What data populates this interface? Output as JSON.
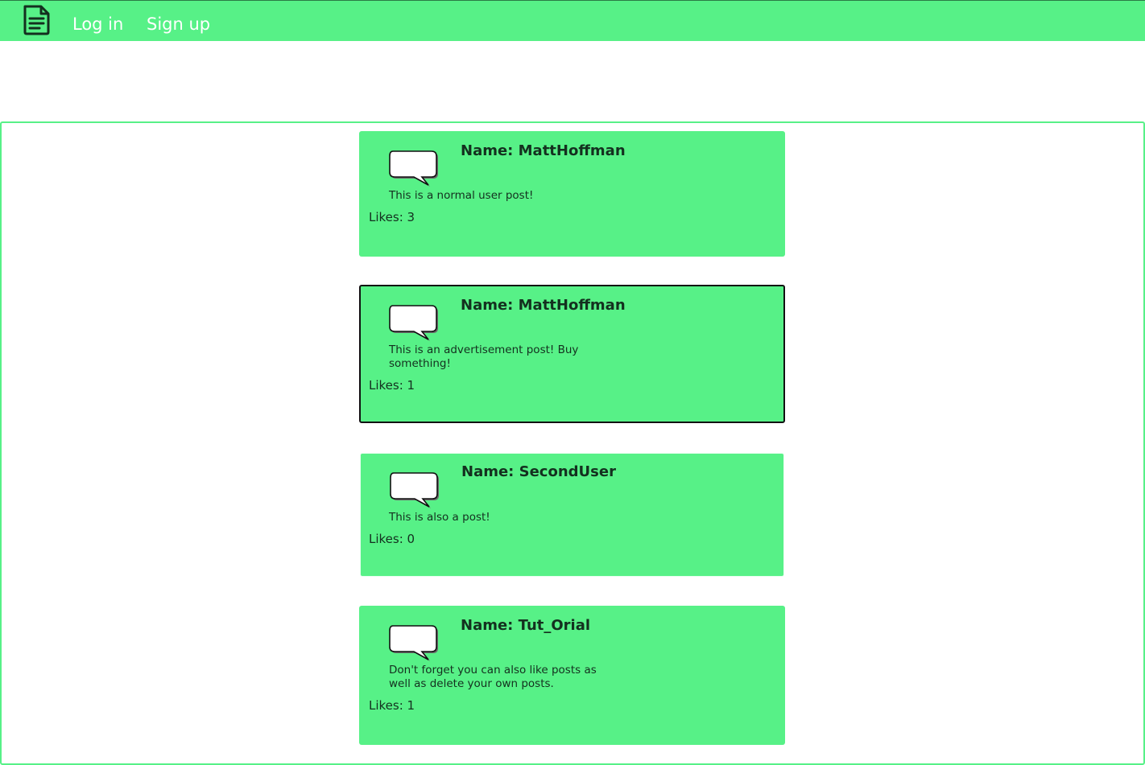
{
  "nav": {
    "logo_icon": "document-icon",
    "login_label": "Log in",
    "signup_label": "Sign up"
  },
  "colors": {
    "accent": "#57f187",
    "text_dark": "#14301f",
    "nav_text": "#ffffff"
  },
  "posts": [
    {
      "name": "Name: MattHoffman",
      "body": "This is a normal user post!",
      "likes": "Likes: 3",
      "icon": "speech-bubble-icon",
      "highlighted": false
    },
    {
      "name": "Name: MattHoffman",
      "body": "This is an advertisement post! Buy something!",
      "likes": "Likes: 1",
      "icon": "speech-bubble-icon",
      "highlighted": true
    },
    {
      "name": "Name: SecondUser",
      "body": "This is also a post!",
      "likes": "Likes: 0",
      "icon": "speech-bubble-icon",
      "highlighted": false
    },
    {
      "name": "Name: Tut_Orial",
      "body": "Don't forget you can also like posts as well as delete your own posts.",
      "likes": "Likes: 1",
      "icon": "speech-bubble-icon",
      "highlighted": false
    }
  ]
}
